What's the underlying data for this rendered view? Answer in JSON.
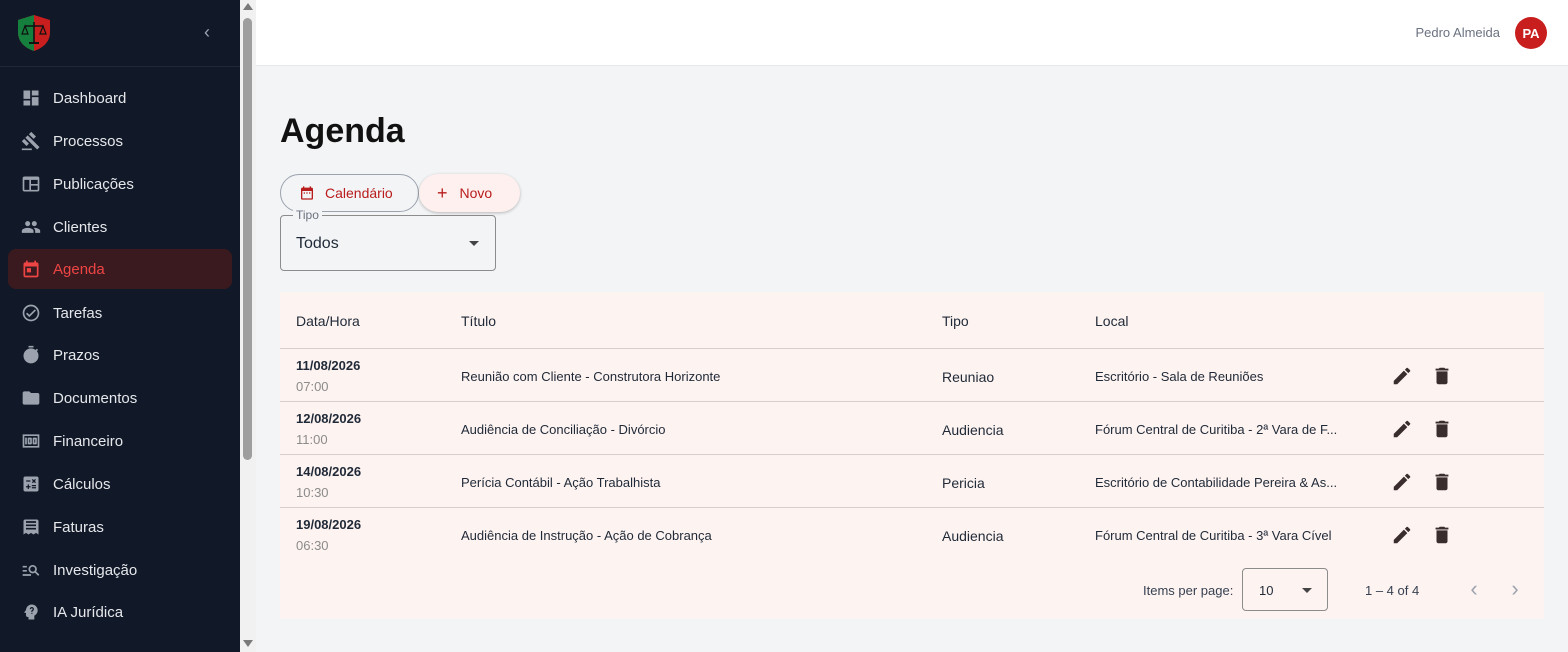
{
  "sidebar": {
    "collapse_glyph": "‹",
    "items": [
      {
        "label": "Dashboard",
        "icon": "dashboard-icon"
      },
      {
        "label": "Processos",
        "icon": "gavel-icon"
      },
      {
        "label": "Publicações",
        "icon": "newspaper-icon"
      },
      {
        "label": "Clientes",
        "icon": "people-icon"
      },
      {
        "label": "Agenda",
        "icon": "calendar-icon",
        "active": true
      },
      {
        "label": "Tarefas",
        "icon": "check-circle-icon"
      },
      {
        "label": "Prazos",
        "icon": "stopwatch-icon"
      },
      {
        "label": "Documentos",
        "icon": "folder-icon"
      },
      {
        "label": "Financeiro",
        "icon": "money-icon"
      },
      {
        "label": "Cálculos",
        "icon": "calculator-icon"
      },
      {
        "label": "Faturas",
        "icon": "receipt-icon"
      },
      {
        "label": "Investigação",
        "icon": "search-list-icon"
      },
      {
        "label": "IA Jurídica",
        "icon": "ai-icon"
      }
    ]
  },
  "header": {
    "user_name": "Pedro Almeida",
    "avatar_initials": "PA"
  },
  "main": {
    "title": "Agenda",
    "calendar_button": "Calendário",
    "new_button": "Novo",
    "filter": {
      "label": "Tipo",
      "value": "Todos"
    },
    "table": {
      "columns": [
        "Data/Hora",
        "Título",
        "Tipo",
        "Local"
      ],
      "rows": [
        {
          "date": "11/08/2026",
          "time": "07:00",
          "title": "Reunião com Cliente - Construtora Horizonte",
          "tipo": "Reuniao",
          "local": "Escritório - Sala de Reuniões"
        },
        {
          "date": "12/08/2026",
          "time": "11:00",
          "title": "Audiência de Conciliação - Divórcio",
          "tipo": "Audiencia",
          "local": "Fórum Central de Curitiba - 2ª Vara de F..."
        },
        {
          "date": "14/08/2026",
          "time": "10:30",
          "title": "Perícia Contábil - Ação Trabalhista",
          "tipo": "Pericia",
          "local": "Escritório de Contabilidade Pereira & As..."
        },
        {
          "date": "19/08/2026",
          "time": "06:30",
          "title": "Audiência de Instrução - Ação de Cobrança",
          "tipo": "Audiencia",
          "local": "Fórum Central de Curitiba - 3ª Vara Cível"
        }
      ]
    },
    "paginator": {
      "items_per_page_label": "Items per page:",
      "page_size": "10",
      "range": "1 – 4 of 4",
      "prev_glyph": "‹",
      "next_glyph": "›"
    }
  },
  "colors": {
    "sidebar_bg": "#111827",
    "accent": "#b91c1c",
    "active_item_bg": "#3a1a1f",
    "table_bg": "#fdf3f1"
  }
}
